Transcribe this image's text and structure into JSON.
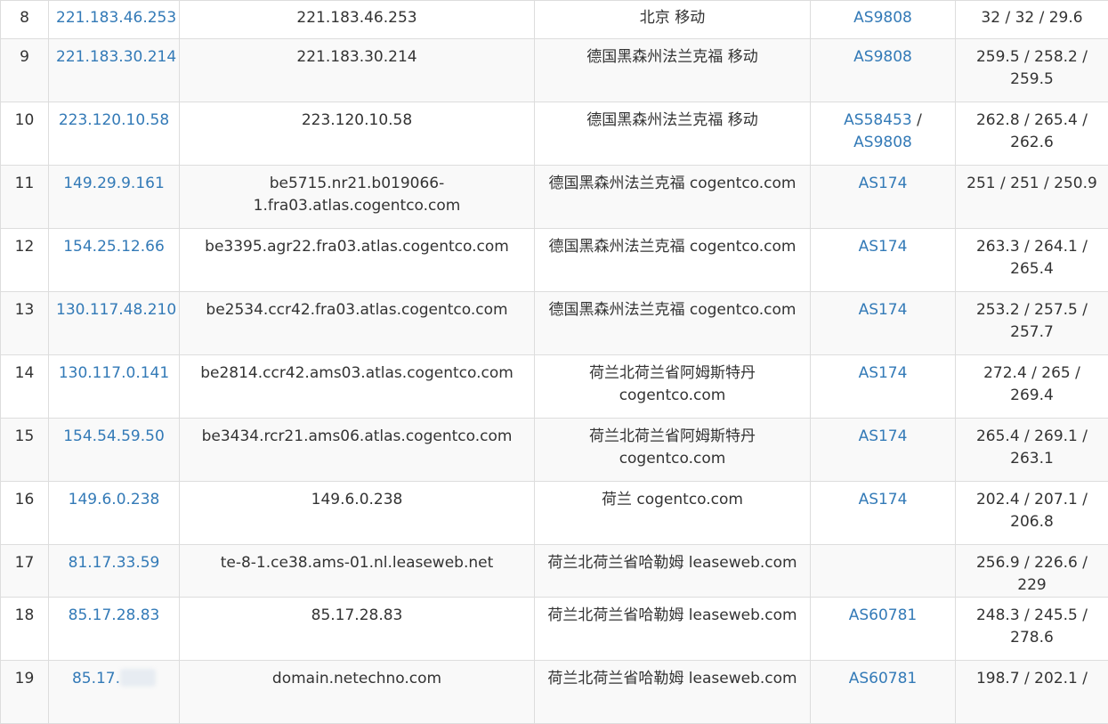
{
  "rows": [
    {
      "hop": "8",
      "ip": "221.183.46.253",
      "host": "221.183.46.253",
      "loc": "北京 移动",
      "asn": [
        "AS9808"
      ],
      "latency": "32 / 32 / 29.6"
    },
    {
      "hop": "9",
      "ip": "221.183.30.214",
      "host": "221.183.30.214",
      "loc": "德国黑森州法兰克福 移动",
      "asn": [
        "AS9808"
      ],
      "latency": "259.5 / 258.2 / 259.5"
    },
    {
      "hop": "10",
      "ip": "223.120.10.58",
      "host": "223.120.10.58",
      "loc": "德国黑森州法兰克福 移动",
      "asn": [
        "AS58453",
        "AS9808"
      ],
      "latency": "262.8 / 265.4 / 262.6"
    },
    {
      "hop": "11",
      "ip": "149.29.9.161",
      "host": "be5715.nr21.b019066-1.fra03.atlas.cogentco.com",
      "loc": "德国黑森州法兰克福 cogentco.com",
      "asn": [
        "AS174"
      ],
      "latency": "251 / 251 / 250.9"
    },
    {
      "hop": "12",
      "ip": "154.25.12.66",
      "host": "be3395.agr22.fra03.atlas.cogentco.com",
      "loc": "德国黑森州法兰克福 cogentco.com",
      "asn": [
        "AS174"
      ],
      "latency": "263.3 / 264.1 / 265.4"
    },
    {
      "hop": "13",
      "ip": "130.117.48.210",
      "host": "be2534.ccr42.fra03.atlas.cogentco.com",
      "loc": "德国黑森州法兰克福 cogentco.com",
      "asn": [
        "AS174"
      ],
      "latency": "253.2 / 257.5 / 257.7"
    },
    {
      "hop": "14",
      "ip": "130.117.0.141",
      "host": "be2814.ccr42.ams03.atlas.cogentco.com",
      "loc": "荷兰北荷兰省阿姆斯特丹 cogentco.com",
      "asn": [
        "AS174"
      ],
      "latency": "272.4 / 265 / 269.4"
    },
    {
      "hop": "15",
      "ip": "154.54.59.50",
      "host": "be3434.rcr21.ams06.atlas.cogentco.com",
      "loc": "荷兰北荷兰省阿姆斯特丹 cogentco.com",
      "asn": [
        "AS174"
      ],
      "latency": "265.4 / 269.1 / 263.1"
    },
    {
      "hop": "16",
      "ip": "149.6.0.238",
      "host": "149.6.0.238",
      "loc": "荷兰 cogentco.com",
      "asn": [
        "AS174"
      ],
      "latency": "202.4 / 207.1 / 206.8"
    },
    {
      "hop": "17",
      "ip": "81.17.33.59",
      "host": "te-8-1.ce38.ams-01.nl.leaseweb.net",
      "loc": "荷兰北荷兰省哈勒姆 leaseweb.com",
      "asn": [],
      "latency": "256.9 / 226.6 / 229"
    },
    {
      "hop": "18",
      "ip": "85.17.28.83",
      "host": "85.17.28.83",
      "loc": "荷兰北荷兰省哈勒姆 leaseweb.com",
      "asn": [
        "AS60781"
      ],
      "latency": "248.3 / 245.5 / 278.6"
    },
    {
      "hop": "19",
      "ip": "85.17.",
      "ip_masked": true,
      "host": "domain.netechno.com",
      "loc": "荷兰北荷兰省哈勒姆 leaseweb.com",
      "asn": [
        "AS60781"
      ],
      "latency": "198.7 / 202.1 /"
    }
  ]
}
